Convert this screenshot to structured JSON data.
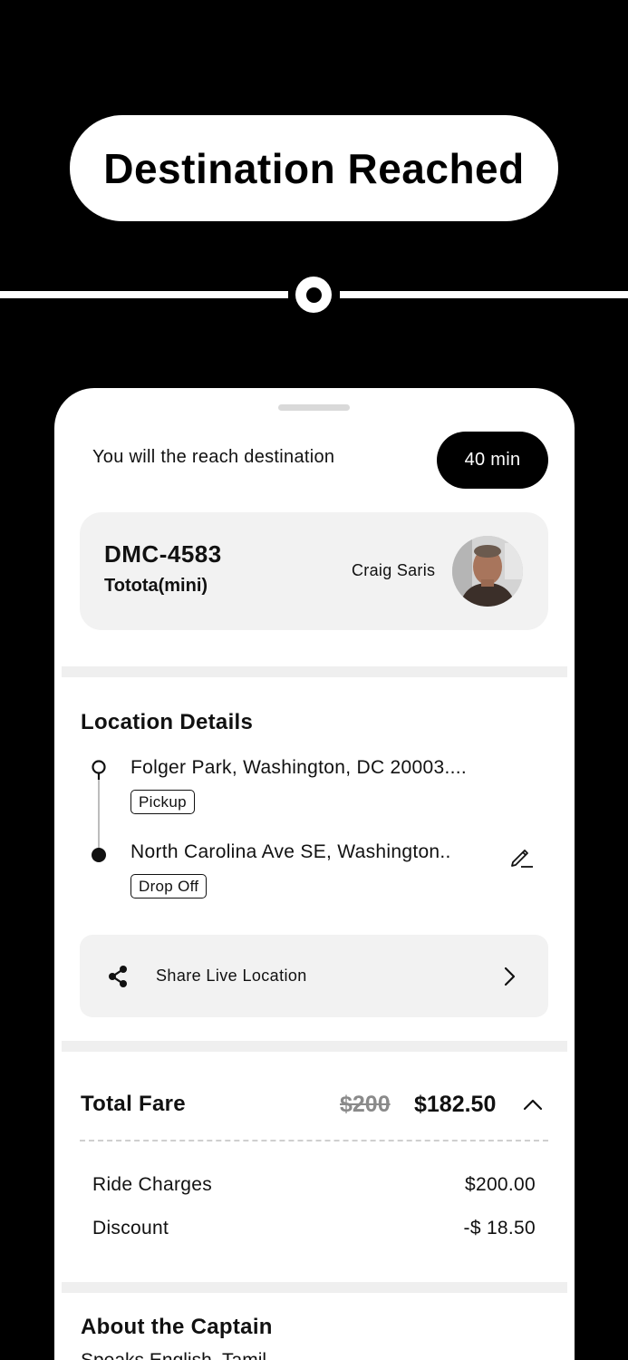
{
  "banner": {
    "title": "Destination Reached"
  },
  "eta": {
    "text": "You will the reach destination",
    "badge": "40 min"
  },
  "vehicle": {
    "plate": "DMC-4583",
    "model": "Tototа(mini)",
    "driver_name": "Craig Saris"
  },
  "location": {
    "title": "Location Details",
    "pickup_address": "Folger Park, Washington, DC 20003....",
    "pickup_tag": "Pickup",
    "dropoff_address": "North Carolina Ave SE, Washington..",
    "dropoff_tag": "Drop Off"
  },
  "share": {
    "label": "Share Live Location"
  },
  "fare": {
    "title": "Total Fare",
    "original": "$200",
    "discounted": "$182.50",
    "ride_charges_label": "Ride Charges",
    "ride_charges_value": "$200.00",
    "discount_label": "Discount",
    "discount_value": "-$ 18.50"
  },
  "captain": {
    "title": "About the Captain",
    "languages": "Speaks English, Tamil"
  },
  "icons": {
    "pickup": "pickup-pin-icon",
    "dropoff": "dropoff-dot-icon",
    "edit": "edit-pencil-icon",
    "share": "share-icon",
    "chevron_right": "chevron-right-icon",
    "chevron_up": "chevron-up-icon"
  },
  "colors": {
    "background": "#000000",
    "card": "#f2f2f2",
    "text": "#111111"
  }
}
